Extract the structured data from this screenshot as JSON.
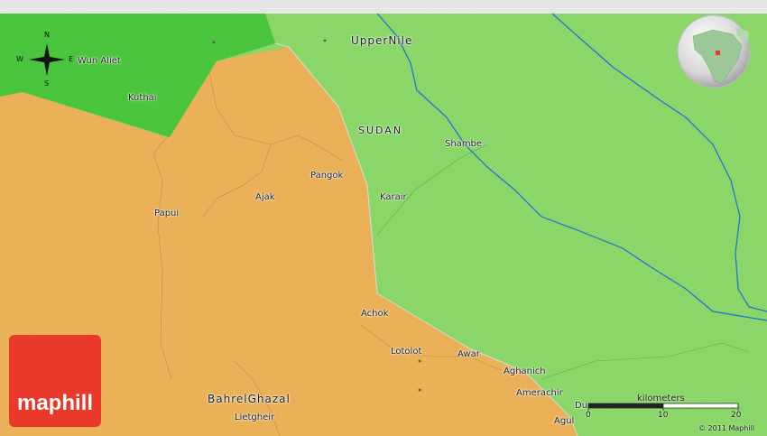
{
  "colors": {
    "admin_orange": "#f0b55c",
    "admin_green_light": "#8fdb6c",
    "admin_green_dark": "#4ec93f",
    "river": "#1d6fd8",
    "brand_red": "#e8392b"
  },
  "regions": {
    "upper_nile": "UpperNile",
    "country": "SUDAN",
    "bahr_el_ghazal": "BahrelGhazal"
  },
  "towns": {
    "wun_aliet": "Wun Aliet",
    "kuthai": "Kuthai",
    "pangok": "Pangok",
    "ajak": "Ajak",
    "papui": "Papui",
    "shambe": "Shambe",
    "karair": "Karair",
    "achok": "Achok",
    "lotolot": "Lotolot",
    "awar": "Awar",
    "aghanich": "Aghanich",
    "amerachir": "Amerachir",
    "agul": "Agul",
    "liet_gheir": "Lietgheir",
    "du": "Du"
  },
  "compass": {
    "n": "N",
    "s": "S",
    "w": "W",
    "e": "E"
  },
  "scale": {
    "title": "kilometers",
    "ticks": [
      "0",
      "10",
      "20"
    ]
  },
  "logo": {
    "text": "maphill",
    "icon": "maphill-logo"
  },
  "copyright": "© 2011 Maphill",
  "globe": {
    "icon": "globe-locator-icon"
  }
}
